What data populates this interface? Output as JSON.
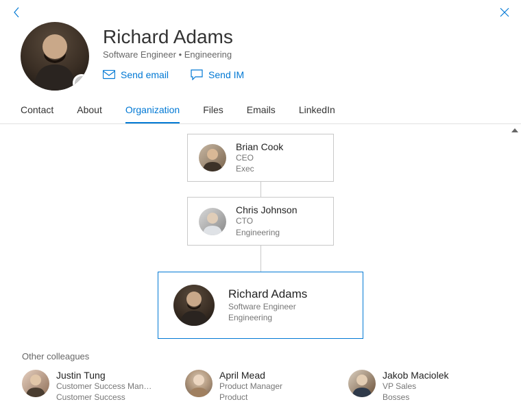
{
  "colors": {
    "accent": "#0078d4"
  },
  "profile": {
    "name": "Richard Adams",
    "title": "Software Engineer",
    "department": "Engineering",
    "subtitle": "Software Engineer  •  Engineering"
  },
  "actions": {
    "send_email": "Send email",
    "send_im": "Send IM"
  },
  "tabs": {
    "contact": "Contact",
    "about": "About",
    "organization": "Organization",
    "files": "Files",
    "emails": "Emails",
    "linkedin": "LinkedIn",
    "active": "organization"
  },
  "org_chain": [
    {
      "name": "Brian Cook",
      "role": "CEO",
      "dept": "Exec"
    },
    {
      "name": "Chris Johnson",
      "role": "CTO",
      "dept": "Engineering"
    },
    {
      "name": "Richard Adams",
      "role": "Software Engineer",
      "dept": "Engineering",
      "current": true
    }
  ],
  "other_colleagues_label": "Other colleagues",
  "colleagues": [
    {
      "name": "Justin Tung",
      "role": "Customer Success Man…",
      "dept": "Customer Success"
    },
    {
      "name": "April Mead",
      "role": "Product Manager",
      "dept": "Product"
    },
    {
      "name": "Jakob Maciolek",
      "role": "VP Sales",
      "dept": "Bosses"
    }
  ]
}
